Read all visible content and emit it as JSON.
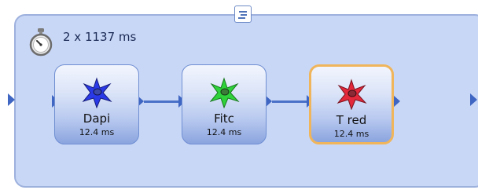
{
  "loop": {
    "timing_label": "2 x 1137 ms"
  },
  "channels": [
    {
      "name": "Dapi",
      "exposure": "12.4 ms",
      "color": "#2a39e8"
    },
    {
      "name": "Fitc",
      "exposure": "12.4 ms",
      "color": "#2fd23a"
    },
    {
      "name": "T red",
      "exposure": "12.4 ms",
      "color": "#e2283a"
    }
  ],
  "colors": {
    "loop_background": "#c9d7f6",
    "connector": "#4a71c8",
    "selection": "#f0b55a"
  },
  "icons": {
    "stopwatch": "stopwatch-icon",
    "collapse": "collapse-icon",
    "channel": "fluorescent-cell-icon"
  }
}
